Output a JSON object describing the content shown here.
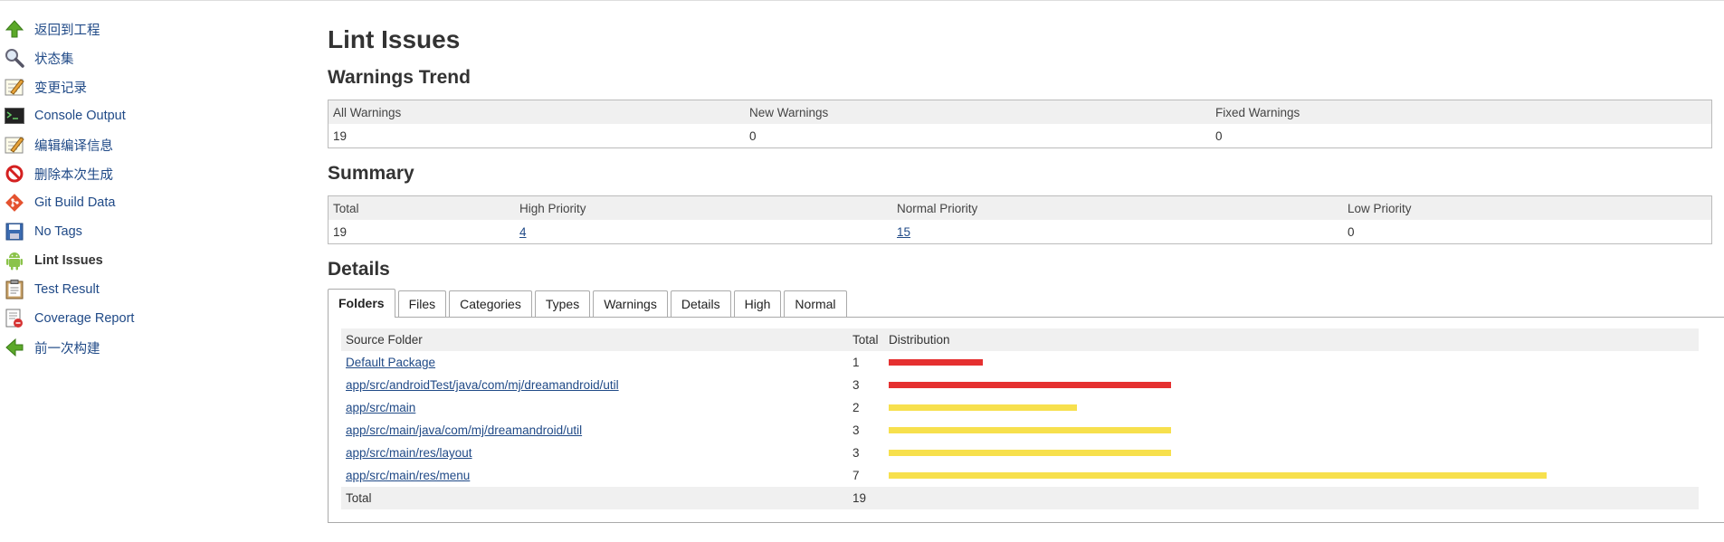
{
  "sidebar": {
    "items": [
      {
        "label": "返回到工程",
        "icon": "up-arrow-icon"
      },
      {
        "label": "状态集",
        "icon": "magnifier-icon"
      },
      {
        "label": "变更记录",
        "icon": "notepad-icon"
      },
      {
        "label": "Console Output",
        "icon": "terminal-icon"
      },
      {
        "label": "编辑编译信息",
        "icon": "notepad-icon"
      },
      {
        "label": "删除本次生成",
        "icon": "no-entry-icon"
      },
      {
        "label": "Git Build Data",
        "icon": "git-icon"
      },
      {
        "label": "No Tags",
        "icon": "save-icon"
      },
      {
        "label": "Lint Issues",
        "icon": "android-icon"
      },
      {
        "label": "Test Result",
        "icon": "clipboard-icon"
      },
      {
        "label": "Coverage Report",
        "icon": "coverage-report-icon"
      },
      {
        "label": "前一次构建",
        "icon": "left-arrow-icon"
      }
    ],
    "active_index": 8
  },
  "page": {
    "title": "Lint Issues",
    "trend_heading": "Warnings Trend",
    "summary_heading": "Summary",
    "details_heading": "Details"
  },
  "trend": {
    "headers": [
      "All Warnings",
      "New Warnings",
      "Fixed Warnings"
    ],
    "values": [
      "19",
      "0",
      "0"
    ]
  },
  "summary": {
    "headers": [
      "Total",
      "High Priority",
      "Normal Priority",
      "Low Priority"
    ],
    "values": [
      "19",
      "4",
      "15",
      "0"
    ]
  },
  "tabs": [
    "Folders",
    "Files",
    "Categories",
    "Types",
    "Warnings",
    "Details",
    "High",
    "Normal"
  ],
  "active_tab": "Folders",
  "details": {
    "headers": [
      "Source Folder",
      "Total",
      "Distribution"
    ],
    "rows": [
      {
        "folder": "Default Package",
        "total": "1",
        "high": 1,
        "normal": 0
      },
      {
        "folder": "app/src/androidTest/java/com/mj/dreamandroid/util",
        "total": "3",
        "high": 3,
        "normal": 0
      },
      {
        "folder": "app/src/main",
        "total": "2",
        "high": 0,
        "normal": 2
      },
      {
        "folder": "app/src/main/java/com/mj/dreamandroid/util",
        "total": "3",
        "high": 0,
        "normal": 3
      },
      {
        "folder": "app/src/main/res/layout",
        "total": "3",
        "high": 0,
        "normal": 3
      },
      {
        "folder": "app/src/main/res/menu",
        "total": "7",
        "high": 0,
        "normal": 7
      }
    ],
    "footer_label": "Total",
    "footer_total": "19",
    "max_total": 7
  },
  "colors": {
    "high": "#E53030",
    "normal": "#F7E04D",
    "link": "#204A87"
  }
}
